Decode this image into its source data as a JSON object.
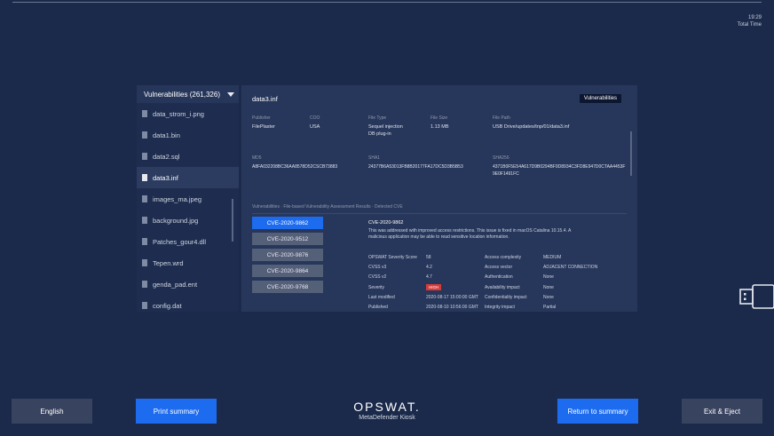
{
  "header": {
    "time": "19:29",
    "time_label": "Total Time"
  },
  "files": {
    "header": "Vulnerabilities (261,326)",
    "items": [
      {
        "name": "data_strom_i.png"
      },
      {
        "name": "data1.bin"
      },
      {
        "name": "data2.sql"
      },
      {
        "name": "data3.inf",
        "active": true
      },
      {
        "name": "images_ma.jpeg"
      },
      {
        "name": "background.jpg"
      },
      {
        "name": "Patches_gour4.dll"
      },
      {
        "name": "Tepen.wrd"
      },
      {
        "name": "genda_pad.ent"
      },
      {
        "name": "config.dat"
      }
    ]
  },
  "details": {
    "filename": "data3.inf",
    "badge": "Vulnerabilities",
    "publisher_label": "Publisher",
    "publisher": "FilePlaster",
    "coo_label": "COO",
    "coo": "USA",
    "filetype_label": "File Type",
    "filetype": "Sequel injection\nDB plug-in",
    "filesize_label": "File Size",
    "filesize": "1.13 MB",
    "filepath_label": "File Path",
    "filepath": "USB Drive/updates/tnp/01/data3.inf",
    "md5_label": "MD5",
    "md5": "A8FA032208BC36AA8578D52CSCB73883",
    "sha1_label": "SHA1",
    "sha1": "24377B6A53013FB8B20177FA17DC5D3B5B53",
    "sha256_label": "SHA256",
    "sha256": "4371B0F5E54A617D9B0294BF9D8934C3FD8E947D0CTAA4453F9E0F1491FC",
    "crumb": "Vulnerabilities · File-based Vulnerability Assessment Results · Detected CVE"
  },
  "cves": [
    {
      "id": "CVE-2020-9862",
      "selected": true
    },
    {
      "id": "CVE-2020-9512"
    },
    {
      "id": "CVE-2020-9876"
    },
    {
      "id": "CVE-2020-9864"
    },
    {
      "id": "CVE-2020-9768"
    }
  ],
  "cve_detail": {
    "title": "CVE-2020-9862",
    "description": "This was addressed with improved access restrictions. This issue is fixed in macOS Catalina 10.15.4. A malicious application may be able to read sensitive location information.",
    "score_label": "OPSWAT Severity Score",
    "score": "58",
    "cvss3_label": "CVSS v3",
    "cvss3": "4.2",
    "cvss2_label": "CVSS v2",
    "cvss2": "4.7",
    "severity_label": "Severity",
    "severity": "HIGH",
    "modified_label": "Last modified",
    "modified": "2020-08-17 15:00:00 GMT",
    "published_label": "Published",
    "published": "2020-08-10 10:56:00 GMT",
    "complexity_label": "Access complexity",
    "complexity": "MEDIUM",
    "vector_label": "Access vector",
    "vector": "ADJACENT CONNECTION",
    "auth_label": "Authentication",
    "auth": "None",
    "avail_label": "Availability impact",
    "avail": "None",
    "conf_label": "Confidentiality impact",
    "conf": "None",
    "integ_label": "Integrity impact",
    "integ": "Partial"
  },
  "footer": {
    "english": "English",
    "print": "Print summary",
    "brand": "OPSWAT.",
    "product": "MetaDefender Kiosk",
    "return": "Return to summary",
    "exit": "Exit & Eject"
  },
  "colors": {
    "accent": "#1d6cf0",
    "background": "#1b2a4b",
    "severity_high": "#d83a3a"
  }
}
